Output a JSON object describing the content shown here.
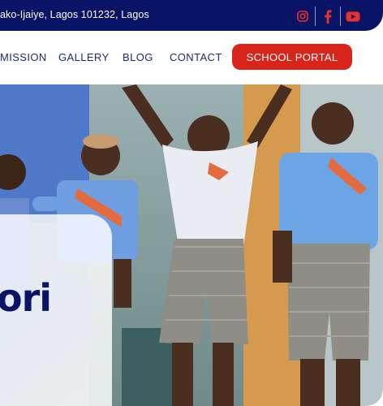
{
  "topbar": {
    "address": "ako-Ijaiye, Lagos 101232, Lagos",
    "socials": [
      {
        "icon": "instagram-icon"
      },
      {
        "icon": "facebook-icon"
      },
      {
        "icon": "youtube-icon"
      }
    ]
  },
  "nav": {
    "items": [
      "MISSION",
      "GALLERY",
      "BLOG",
      "CONTACT"
    ],
    "portal_label": "SCHOOL PORTAL"
  },
  "hero": {
    "heading": "ori"
  },
  "colors": {
    "navy": "#0a1466",
    "accent_red": "#d8251c",
    "nav_text": "#1c2a70"
  }
}
